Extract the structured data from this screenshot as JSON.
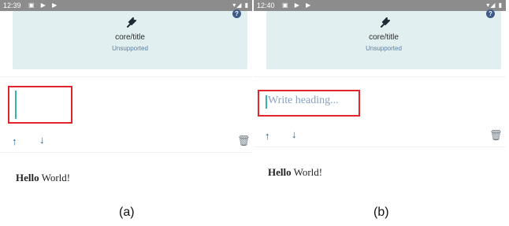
{
  "panels": [
    {
      "status_time": "12:39",
      "status_left_icons": "▣ ▶ ▶",
      "status_right_icons": "▾◢ ▮",
      "block_title": "core/title",
      "block_subtitle": "Unsupported",
      "heading_placeholder": "",
      "paragraph_bold": "Hello",
      "paragraph_rest": " World!",
      "caption": "(a)"
    },
    {
      "status_time": "12:40",
      "status_left_icons": "▣ ▶ ▶",
      "status_right_icons": "▾◢ ▮",
      "block_title": "core/title",
      "block_subtitle": "Unsupported",
      "heading_placeholder": "Write heading...",
      "paragraph_bold": "Hello",
      "paragraph_rest": " World!",
      "caption": "(b)"
    }
  ],
  "icons": {
    "plug": "plug-icon",
    "help": "help-icon",
    "move_up": "arrow-up-icon",
    "move_down": "arrow-down-icon",
    "delete": "trash-icon"
  },
  "colors": {
    "highlight_box": "#e0252d",
    "caret": "#36b3aa",
    "unsupported_bg": "#e2eff0",
    "toolbar_icon": "#1e5f99"
  }
}
